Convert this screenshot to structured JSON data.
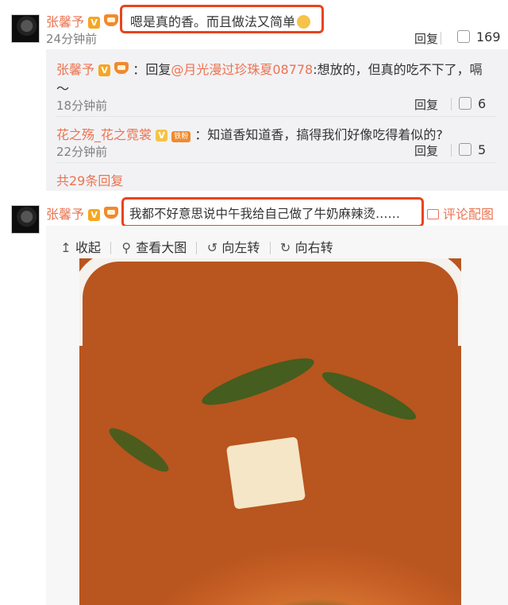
{
  "comment1": {
    "username": "张馨予",
    "text": "嗯是真的香。而且做法又简单",
    "time": "24分钟前",
    "reply_label": "回复",
    "likes": "169"
  },
  "replies": [
    {
      "username": "张馨予",
      "reply_word": "回复",
      "mention": "@月光漫过珍珠夏08778",
      "text_line1": ":想放的，但真的吃不下了，嗝",
      "text_line2": "～",
      "time": "18分钟前",
      "reply_label": "回复",
      "likes": "6"
    },
    {
      "username": "花之殇_花之霓裳",
      "badge": "铁粉",
      "text": "：知道香知道香，搞得我们好像吃得着似的?",
      "time": "22分钟前",
      "reply_label": "回复",
      "likes": "5"
    }
  ],
  "more_replies": "共29条回复",
  "comment2": {
    "username": "张馨予",
    "text": "我都不好意思说中午我给自己做了牛奶麻辣烫……",
    "image_comment": "评论配图"
  },
  "toolbar": {
    "collapse": "收起",
    "view_large": "查看大图",
    "rotate_left": "向左转",
    "rotate_right": "向右转"
  },
  "colors": {
    "username": "#eb7350",
    "highlight": "#e8441f",
    "reply_bg": "#f2f2f5"
  }
}
